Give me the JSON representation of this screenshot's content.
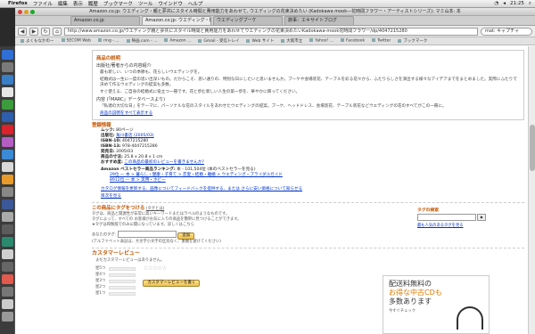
{
  "menubar": {
    "app": "Firefox",
    "items": [
      "ファイル",
      "編集",
      "表示",
      "履歴",
      "ブックマーク",
      "ツール",
      "ウインドウ",
      "ヘルプ"
    ],
    "clock": "21:25"
  },
  "window": {
    "title": "Amazon.co.jp: ウエディング・親と夢共にスタイル時間と費用能力をあわせて, ウエディングの花束決めたい (Kadokawa mook―花時間フラワー・アーティストシリーズ): マミ山本: 本"
  },
  "tabs": [
    {
      "label": "Amazon.co.jp"
    },
    {
      "label": "Amazon.co.jp: ウエディング・親..."
    },
    {
      "label": "ウエディングブーケ"
    },
    {
      "label": "旅事：エキサイトブログ"
    }
  ],
  "toolbar": {
    "url": "http://www.amazon.co.jp/ウエディング親と夢共にスタイル時間と費用能力をあわせてウエディングの花束決めたいKadokawa-mook花時間フラワー/dp/4047215280",
    "search_placeholder": "mat: キャプチャ"
  },
  "bookmarks": [
    "よくもなかのー",
    "SECOM Web",
    "ring - ...",
    "映画.com - ...",
    "Amazon ...",
    "Gmail - 受信トレイ",
    "Web サイト",
    "大阪市立",
    "Yahoo! ...",
    "Facebook",
    "Twitter",
    "ブックマーク"
  ],
  "review": {
    "section_title": "商品の説明",
    "sub1": "出版社/著者からの内容紹介",
    "para1": "最も新しい、いつの季節も、花らしいウエディングを。",
    "para2": "結婚式は一生に一度の思い出深いもの。だからこそ、思い通りの、特別な日にしたいと思いませんか。ブーケや会場装花、テーブルを彩る花々から、ふたりらしさを演出する様々なアイデアまでをまとめました。実際にふたりで決めて作るウエディングの提案も多数。",
    "para3": "すぐ使える、ご自身の結婚式に役立つ一冊です。花と歩む新しい人生の第一歩を、華やかに飾ってください。",
    "sub2": "内容 (「MARC」データベースより)",
    "para4": "「私達の大切な日」をテーマに、パーソナルな花のスタイルをあわせたウエディングの提案。ブーケ、ヘッドドレス、会場装花、テーブル装花などウエディングの花のすべてがこの一冊に。",
    "more_link": "商品の説明をすべて表示する"
  },
  "details": {
    "section_title": "登録情報",
    "rows": [
      {
        "k": "ムック:",
        "v": "80ページ"
      },
      {
        "k": "出版社:",
        "v": "角川書店 (2005/03)"
      },
      {
        "k": "ISBN-10:",
        "v": "4047215280"
      },
      {
        "k": "ISBN-13:",
        "v": "978-4047215286"
      },
      {
        "k": "発売日:",
        "v": "2005/03"
      },
      {
        "k": "商品の寸法:",
        "v": "25.8 x 20.8 x 1 cm"
      },
      {
        "k": "おすすめ度:",
        "v": "この商品の最初のレビューを書きませんか?"
      }
    ],
    "rank_label": "Amazon ベストセラー商品ランキング:",
    "rank_value": "本 - 101,504位 (本のベストセラーを見る)",
    "rank2": "29位 ― 本 > 暮らし・健康・子育て > 恋愛・結婚・離婚 > ウエディング・ブライダルガイド",
    "rank3": "8912位 ― 本 > 実用・ホビー",
    "feedback": "カタログ情報を更新する、画像についてフィードバックを提供する、または さらに安い価格について知らせる",
    "top_link": "目次を見る"
  },
  "tags": {
    "title": "この商品にタグをつける",
    "what": "(タグとは)",
    "desc1": "タグは、商品と関連性が非常に高いキーワードまたはラベルのようなものです。",
    "desc2": "タグによって、すべての お客様がお気に入りの商品を簡単に見つけることができます。",
    "desc3": "★タグは和製版でのみ公開になっています。詳しくはこちら",
    "input_label": "あなたのタグ:",
    "button": "追加",
    "hint": "(アルファベット表記は、大文字小文字の区別なく、重複を避けてください)",
    "search_title": "タグの検索",
    "popular": "最も人気のあるタグを見る"
  },
  "reviews": {
    "title": "カスタマーレビュー",
    "none": "まだカスタマーレビューはありません。",
    "stars_label": "☆☆☆☆☆",
    "rows": [
      "星5つ",
      "星4つ",
      "星3つ",
      "星2つ",
      "星1つ"
    ],
    "write_button": "カスタマーレビューを書く"
  },
  "ad": {
    "line1": "配送料無料の",
    "line2": "お得な中古CDも",
    "line3": "多数あります",
    "footer": "今すぐチェック"
  },
  "colors": {
    "accent": "#c45500",
    "link": "#0033cc",
    "ad_orange": "#e07b00"
  }
}
